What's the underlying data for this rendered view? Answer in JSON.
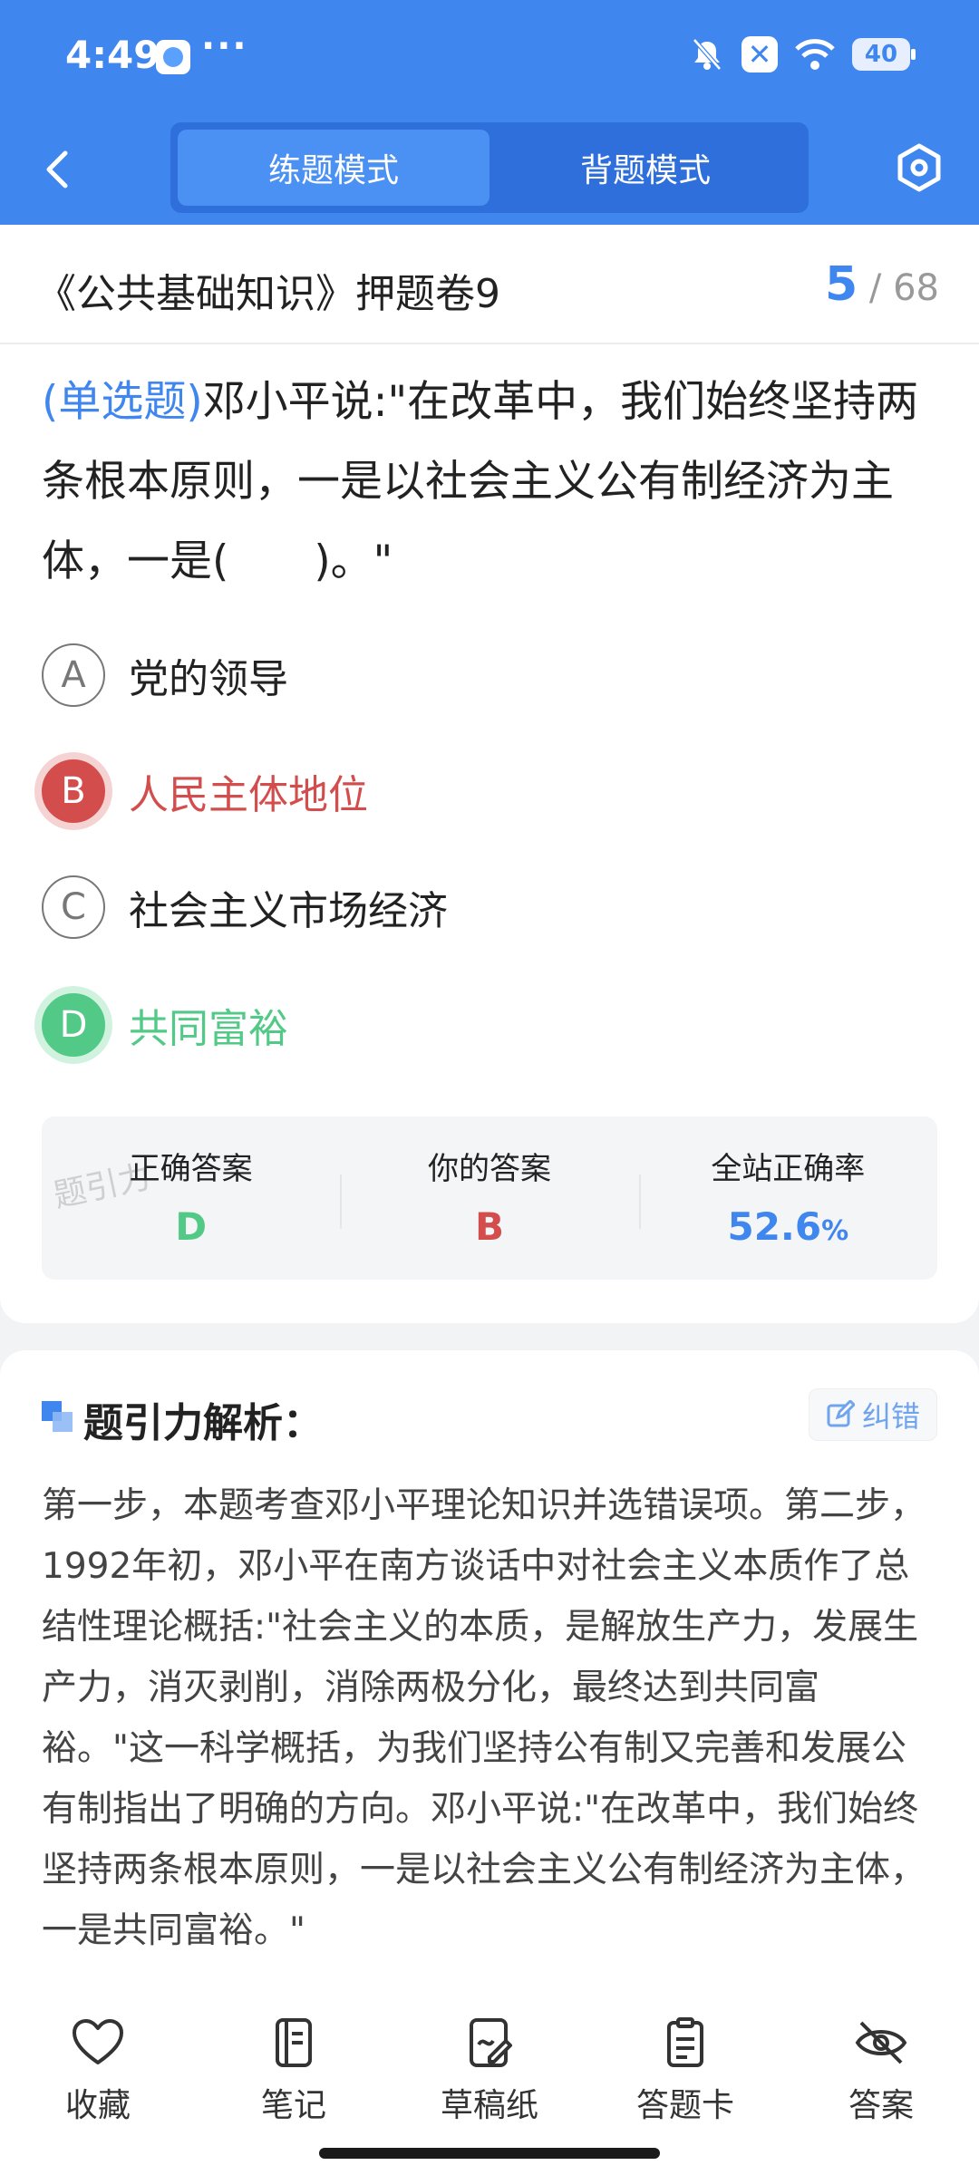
{
  "status_bar": {
    "time": "4:49",
    "more": "···",
    "battery": "40"
  },
  "nav": {
    "tabs": [
      {
        "label": "练题模式",
        "active": true
      },
      {
        "label": "背题模式",
        "active": false
      }
    ]
  },
  "exam": {
    "title": "《公共基础知识》押题卷9",
    "current": "5",
    "total": "/ 68"
  },
  "question": {
    "type": "(单选题)",
    "text": "邓小平说:\"在改革中，我们始终坚持两条根本原则，一是以社会主义公有制经济为主体，一是(　　)。\"",
    "options": [
      {
        "letter": "A",
        "text": "党的领导",
        "state": "normal"
      },
      {
        "letter": "B",
        "text": "人民主体地位",
        "state": "wrong"
      },
      {
        "letter": "C",
        "text": "社会主义市场经济",
        "state": "normal"
      },
      {
        "letter": "D",
        "text": "共同富裕",
        "state": "correct"
      }
    ]
  },
  "answer_summary": {
    "correct_label": "正确答案",
    "correct_value": "D",
    "user_label": "你的答案",
    "user_value": "B",
    "rate_label": "全站正确率",
    "rate_value": "52.6",
    "rate_unit": "%",
    "watermark": "题引力"
  },
  "analysis": {
    "title": "题引力解析：",
    "fix_label": "纠错",
    "body": "第一步，本题考查邓小平理论知识并选错误项。第二步，1992年初，邓小平在南方谈话中对社会主义本质作了总结性理论概括:\"社会主义的本质，是解放生产力，发展生产力，消灭剥削，消除两极分化，最终达到共同富裕。\"这一科学概括，为我们坚持公有制又完善和发展公有制指出了明确的方向。邓小平说:\"在改革中，我们始终坚持两条根本原则，一是以社会主义公有制经济为主体，一是共同富裕。\""
  },
  "bottom_bar": {
    "items": [
      {
        "label": "收藏",
        "icon": "heart-icon"
      },
      {
        "label": "笔记",
        "icon": "notebook-icon"
      },
      {
        "label": "草稿纸",
        "icon": "draft-icon"
      },
      {
        "label": "答题卡",
        "icon": "answer-card-icon"
      },
      {
        "label": "答案",
        "icon": "eye-off-icon"
      }
    ]
  },
  "colors": {
    "primary": "#3f86ee",
    "correct": "#52c986",
    "wrong": "#d34d4d"
  }
}
